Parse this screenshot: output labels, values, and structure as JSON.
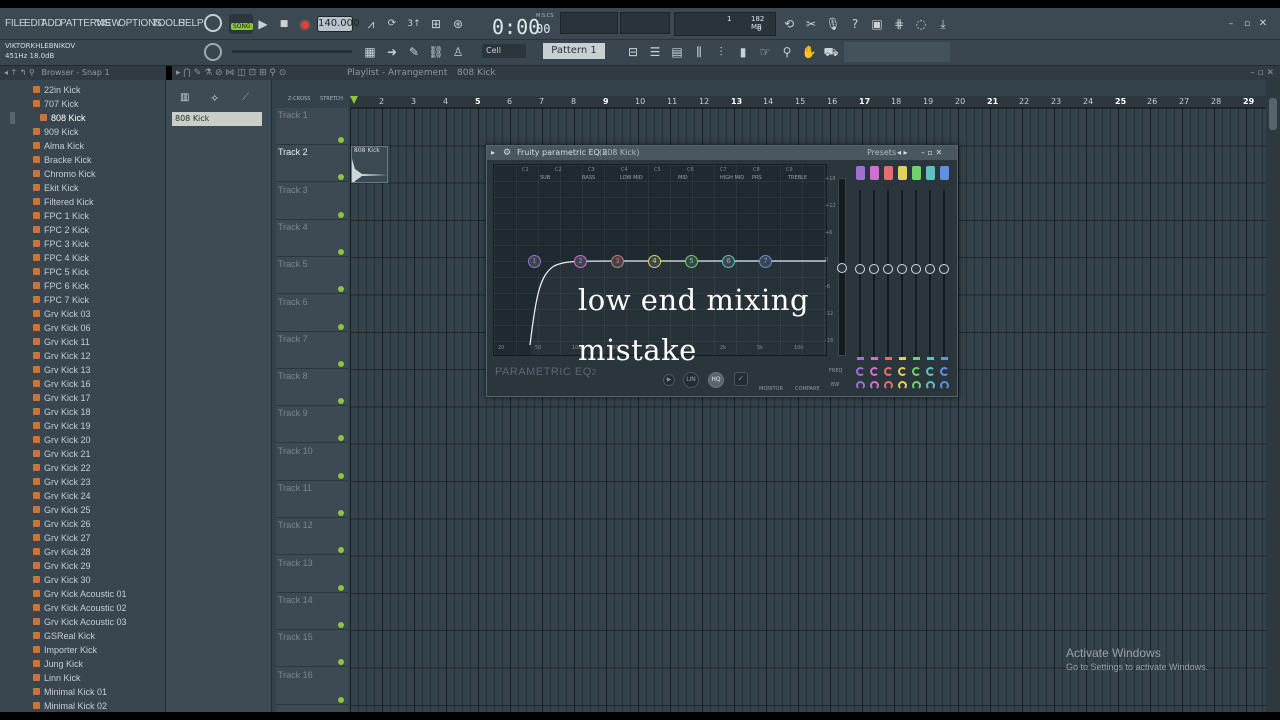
{
  "menu": [
    "FILE",
    "EDIT",
    "ADD",
    "PATTERNS",
    "VIEW",
    "OPTIONS",
    "TOOLS",
    "HELP"
  ],
  "transport": {
    "mode": "SONG",
    "tempo": "140.000",
    "time": "0:00",
    "time_small": "00",
    "time_unit": "M:S:CS"
  },
  "monitor": {
    "cpu": "1",
    "ram": "182 MB",
    "poly": "0"
  },
  "hint": {
    "user": "VIKTORKHLEBNIKOV",
    "readout": "451Hz 18.0dB"
  },
  "toolbar2": {
    "snap": "Cell",
    "pattern": "Pattern 1"
  },
  "browser": {
    "title": "Browser - Snap 1",
    "items": [
      "22in Kick",
      "707 Kick",
      "808 Kick",
      "909 Kick",
      "Alma Kick",
      "Bracke Kick",
      "Chromo Kick",
      "Ekit Kick",
      "Filtered Kick",
      "FPC 1 Kick",
      "FPC 2 Kick",
      "FPC 3 Kick",
      "FPC 4 Kick",
      "FPC 5 Kick",
      "FPC 6 Kick",
      "FPC 7 Kick",
      "Grv Kick 03",
      "Grv Kick 06",
      "Grv Kick 11",
      "Grv Kick 12",
      "Grv Kick 13",
      "Grv Kick 16",
      "Grv Kick 17",
      "Grv Kick 18",
      "Grv Kick 19",
      "Grv Kick 20",
      "Grv Kick 21",
      "Grv Kick 22",
      "Grv Kick 23",
      "Grv Kick 24",
      "Grv Kick 25",
      "Grv Kick 26",
      "Grv Kick 27",
      "Grv Kick 28",
      "Grv Kick 29",
      "Grv Kick 30",
      "Grv Kick Acoustic 01",
      "Grv Kick Acoustic 02",
      "Grv Kick Acoustic 03",
      "GSReal Kick",
      "Importer Kick",
      "Jung Kick",
      "Linn Kick",
      "Minimal Kick 01",
      "Minimal Kick 02"
    ],
    "selected": "808 Kick"
  },
  "channel": {
    "name": "808 Kick"
  },
  "playlist": {
    "title": "Playlist - Arrangement",
    "crumb": "808 Kick",
    "tools": [
      "Z-CROSS",
      "STRETCH"
    ],
    "ruler": [
      "2",
      "3",
      "4",
      "5",
      "6",
      "7",
      "8",
      "9",
      "10",
      "11",
      "12",
      "13",
      "14",
      "15",
      "16",
      "17",
      "18",
      "19",
      "20",
      "21",
      "22",
      "23",
      "24",
      "25",
      "26",
      "27",
      "28",
      "29"
    ],
    "tracks": [
      "Track 1",
      "Track 2",
      "Track 3",
      "Track 4",
      "Track 5",
      "Track 6",
      "Track 7",
      "Track 8",
      "Track 9",
      "Track 10",
      "Track 11",
      "Track 12",
      "Track 13",
      "Track 14",
      "Track 15",
      "Track 16"
    ],
    "clip": "808 Kick"
  },
  "eq": {
    "title": "Fruity parametric EQ 2",
    "subtitle": "(808 Kick)",
    "presets": "Presets",
    "freqs": [
      "C1",
      "C2",
      "C3",
      "C4",
      "C5",
      "C6",
      "C7",
      "C8",
      "C9"
    ],
    "bands": [
      "SUB",
      "BASS",
      "LOW MID",
      "MID",
      "HIGH MID",
      "PRS",
      "TREBLE"
    ],
    "nodes": [
      "1",
      "2",
      "3",
      "4",
      "5",
      "6",
      "7"
    ],
    "node_colors": [
      "#a070d0",
      "#d070d0",
      "#e07070",
      "#e0d060",
      "#70d070",
      "#60c0c0",
      "#6090e0"
    ],
    "db": [
      "+18",
      "+12",
      "+6",
      "0",
      "-6",
      "-12",
      "-18"
    ],
    "hz": [
      "20",
      "50",
      "100",
      "200",
      "500",
      "1k",
      "2k",
      "5k",
      "10k"
    ],
    "logo": "PARAMETRIC EQ",
    "logo_num": "2",
    "buttons": [
      "LIN",
      "HQ"
    ],
    "monitor": "MONITOR",
    "compare": "COMPARE",
    "freq_label": "FREQ",
    "bw_label": "BW"
  },
  "overlay": {
    "line1": "low end mixing",
    "line2": "mistake"
  },
  "watermark": {
    "title": "Activate Windows",
    "sub": "Go to Settings to activate Windows."
  }
}
